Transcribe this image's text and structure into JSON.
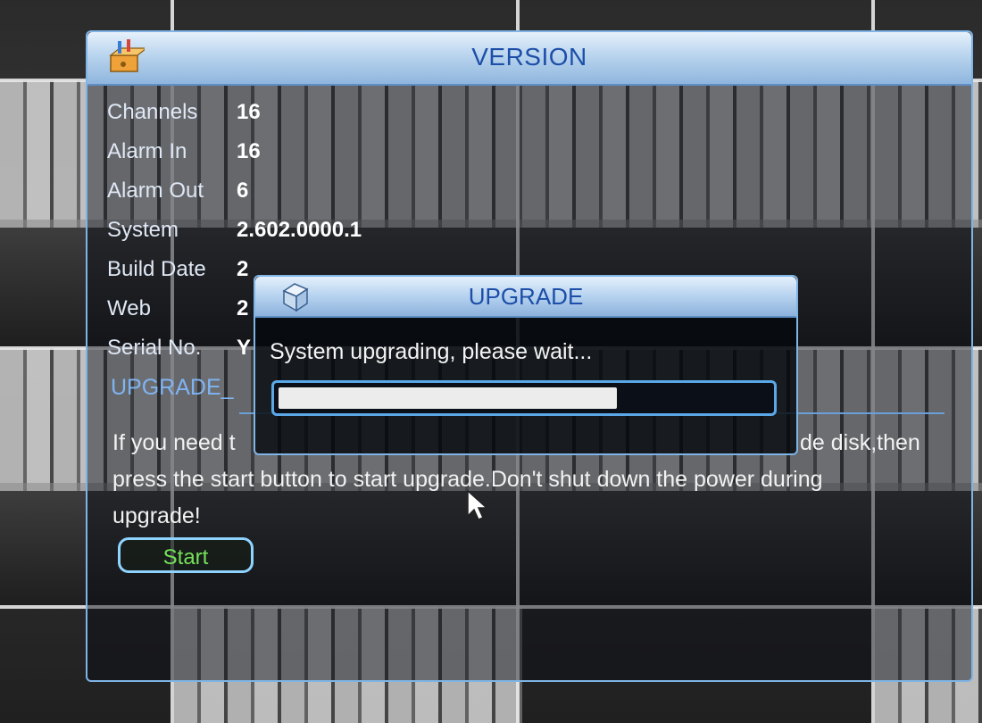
{
  "version_window": {
    "title": "VERSION",
    "info": [
      {
        "label": "Channels",
        "value": "16"
      },
      {
        "label": "Alarm In",
        "value": "16"
      },
      {
        "label": "Alarm Out",
        "value": "6"
      },
      {
        "label": "System",
        "value": "2.602.0000.1"
      },
      {
        "label": "Build Date",
        "value": "2"
      },
      {
        "label": "Web",
        "value": "2"
      },
      {
        "label": "Serial No.",
        "value": "Y"
      }
    ],
    "section_title": "UPGRADE_",
    "description_line1": "If you need t",
    "description_line1_end": "de disk,then",
    "description_line2": "press the start button to start upgrade.Don't shut down the power during",
    "description_line3": "upgrade!",
    "start_label": "Start"
  },
  "upgrade_dialog": {
    "title": "UPGRADE",
    "message": "System upgrading, please wait...",
    "progress": 0.69
  },
  "colors": {
    "accent_blue": "#7fb4e6",
    "title_text": "#1d4fa8",
    "start_green": "#74e05a"
  },
  "icons": {
    "version_icon": "tools-box-icon",
    "upgrade_icon": "upgrade-cube-icon",
    "cursor": "mouse-pointer-icon"
  }
}
